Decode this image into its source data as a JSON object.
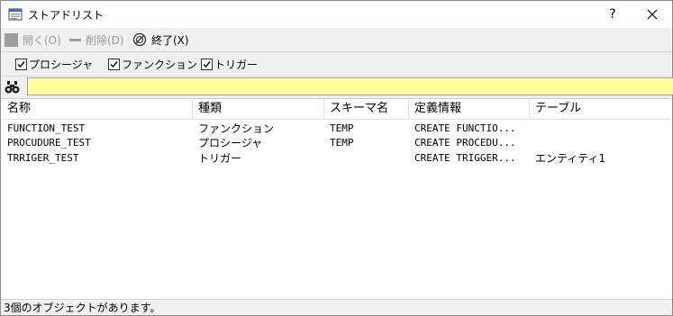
{
  "window": {
    "title": "ストアドリスト",
    "help_label": "?",
    "app_icon": "window-list-icon"
  },
  "toolbar": {
    "open_label": "開く(O)",
    "delete_label": "削除(D)",
    "exit_label": "終了(X)"
  },
  "filters": [
    {
      "label": "プロシージャ",
      "checked": true
    },
    {
      "label": "ファンクション",
      "checked": true
    },
    {
      "label": "トリガー",
      "checked": true
    }
  ],
  "search": {
    "value": "",
    "background": "#ffffa0"
  },
  "list": {
    "columns": [
      "名称",
      "種類",
      "スキーマ名",
      "定義情報",
      "テーブル"
    ],
    "rows": [
      [
        "FUNCTION_TEST",
        "ファンクション",
        "TEMP",
        "CREATE FUNCTIO...",
        ""
      ],
      [
        "PROCUDURE_TEST",
        "プロシージャ",
        "TEMP",
        "CREATE PROCEDU...",
        ""
      ],
      [
        "TRRIGER_TEST",
        "トリガー",
        "",
        "CREATE TRIGGER...",
        "エンティティ1"
      ]
    ]
  },
  "status": {
    "text": "3個のオブジェクトがあります。"
  }
}
